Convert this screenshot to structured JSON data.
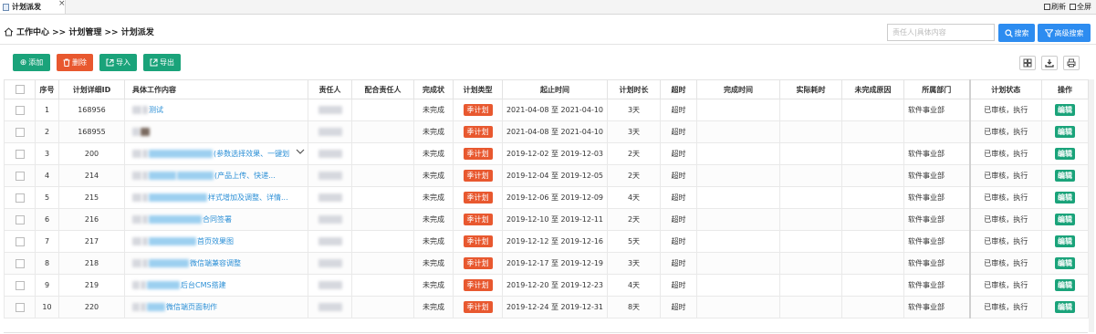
{
  "tab": {
    "label": "计划派发",
    "close": "×"
  },
  "topbar": {
    "refresh": "刷新",
    "fullscreen": "全屏"
  },
  "breadcrumb": "工作中心 >> 计划管理 >> 计划派发",
  "search": {
    "placeholder": "责任人|具体内容",
    "search_label": "搜索",
    "advanced_label": "高级搜索"
  },
  "actions": {
    "add": "添加",
    "delete": "删除",
    "import": "导入",
    "export": "导出"
  },
  "table": {
    "headers": [
      "序号",
      "计划详细ID",
      "具体工作内容",
      "责任人",
      "配合责任人",
      "完成状",
      "计划类型",
      "起止时间",
      "计划时长",
      "超时",
      "完成时间",
      "实际耗时",
      "未完成原因",
      "所属部门",
      "计划状态",
      "操作"
    ],
    "rows": [
      {
        "no": "1",
        "id": "168956",
        "content": "测试",
        "status": "未完成",
        "type": "季计划",
        "period": "2021-04-08 至 2021-04-10",
        "duration": "3天",
        "overtime": "超时",
        "dept": "软件事业部",
        "plan_status": "已审核，执行",
        "op": "编辑"
      },
      {
        "no": "2",
        "id": "168955",
        "content": "",
        "status": "未完成",
        "type": "季计划",
        "period": "2021-04-08 至 2021-04-10",
        "duration": "3天",
        "overtime": "超时",
        "dept": "",
        "plan_status": "已审核，执行",
        "op": "编辑"
      },
      {
        "no": "3",
        "id": "200",
        "content": "(参数选择效果、一键划",
        "status": "未完成",
        "type": "季计划",
        "period": "2019-12-02 至 2019-12-03",
        "duration": "2天",
        "overtime": "超时",
        "dept": "软件事业部",
        "plan_status": "已审核，执行",
        "op": "编辑"
      },
      {
        "no": "4",
        "id": "214",
        "content": "(产品上传、快递...",
        "status": "未完成",
        "type": "季计划",
        "period": "2019-12-04 至 2019-12-05",
        "duration": "2天",
        "overtime": "超时",
        "dept": "软件事业部",
        "plan_status": "已审核，执行",
        "op": "编辑"
      },
      {
        "no": "5",
        "id": "215",
        "content": "样式增加及调整、详情...",
        "status": "未完成",
        "type": "季计划",
        "period": "2019-12-06 至 2019-12-09",
        "duration": "4天",
        "overtime": "超时",
        "dept": "软件事业部",
        "plan_status": "已审核，执行",
        "op": "编辑"
      },
      {
        "no": "6",
        "id": "216",
        "content": "合同签署",
        "status": "未完成",
        "type": "季计划",
        "period": "2019-12-10 至 2019-12-11",
        "duration": "2天",
        "overtime": "超时",
        "dept": "软件事业部",
        "plan_status": "已审核，执行",
        "op": "编辑"
      },
      {
        "no": "7",
        "id": "217",
        "content": "首页效果图",
        "status": "未完成",
        "type": "季计划",
        "period": "2019-12-12 至 2019-12-16",
        "duration": "5天",
        "overtime": "超时",
        "dept": "软件事业部",
        "plan_status": "已审核，执行",
        "op": "编辑"
      },
      {
        "no": "8",
        "id": "218",
        "content": "微信端兼容调整",
        "status": "未完成",
        "type": "季计划",
        "period": "2019-12-17 至 2019-12-19",
        "duration": "3天",
        "overtime": "超时",
        "dept": "软件事业部",
        "plan_status": "已审核，执行",
        "op": "编辑"
      },
      {
        "no": "9",
        "id": "219",
        "content": "后台CMS搭建",
        "status": "未完成",
        "type": "季计划",
        "period": "2019-12-20 至 2019-12-23",
        "duration": "4天",
        "overtime": "超时",
        "dept": "软件事业部",
        "plan_status": "已审核，执行",
        "op": "编辑"
      },
      {
        "no": "10",
        "id": "220",
        "content": "微信端页面制作",
        "status": "未完成",
        "type": "季计划",
        "period": "2019-12-24 至 2019-12-31",
        "duration": "8天",
        "overtime": "超时",
        "dept": "软件事业部",
        "plan_status": "已审核，执行",
        "op": "编辑"
      }
    ]
  },
  "colors": {
    "primary": "#2d8cf0",
    "success": "#1aa37a",
    "danger": "#e8582f",
    "status_red": "#e52b2b",
    "status_green": "#1a9b4a",
    "link": "#2b8fd6"
  }
}
